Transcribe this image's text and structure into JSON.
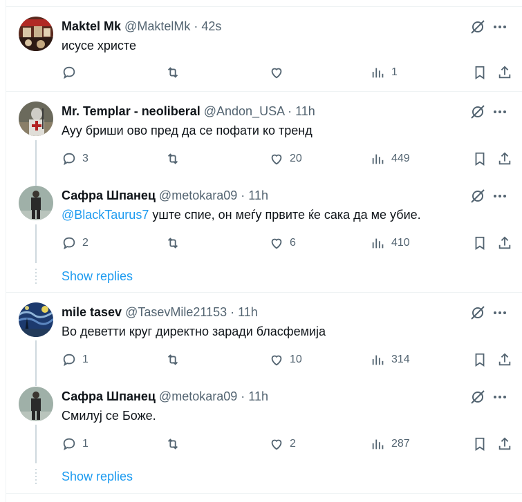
{
  "tweets": [
    {
      "name": "Maktel Mk",
      "handle": "@MaktelMk",
      "time": "42s",
      "text": "исусе христе",
      "mention": "",
      "replies": "",
      "likes": "",
      "views": "1"
    },
    {
      "name": "Mr. Templar - neoliberal",
      "handle": "@Andon_USA",
      "time": "11h",
      "text": "Ауу бриши ово пред да се пофати ко тренд",
      "mention": "",
      "replies": "3",
      "likes": "20",
      "views": "449"
    },
    {
      "name": "Сафра Шпанец",
      "handle": "@metokara09",
      "time": "11h",
      "text": " уште спие, он меѓу првите ќе сака да ме убие.",
      "mention": "@BlackTaurus7",
      "replies": "2",
      "likes": "6",
      "views": "410"
    },
    {
      "name": "mile tasev",
      "handle": "@TasevMile21153",
      "time": "11h",
      "text": "Во деветти круг директно заради бласфемија",
      "mention": "",
      "replies": "1",
      "likes": "10",
      "views": "314"
    },
    {
      "name": "Сафра Шпанец",
      "handle": "@metokara09",
      "time": "11h",
      "text": "Смилуј се Боже.",
      "mention": "",
      "replies": "1",
      "likes": "2",
      "views": "287"
    }
  ],
  "show_replies_label": "Show replies",
  "separator": "·",
  "colors": {
    "accent": "#1d9bf0",
    "muted": "#536471",
    "text": "#0f1419",
    "border": "#eff3f4"
  }
}
